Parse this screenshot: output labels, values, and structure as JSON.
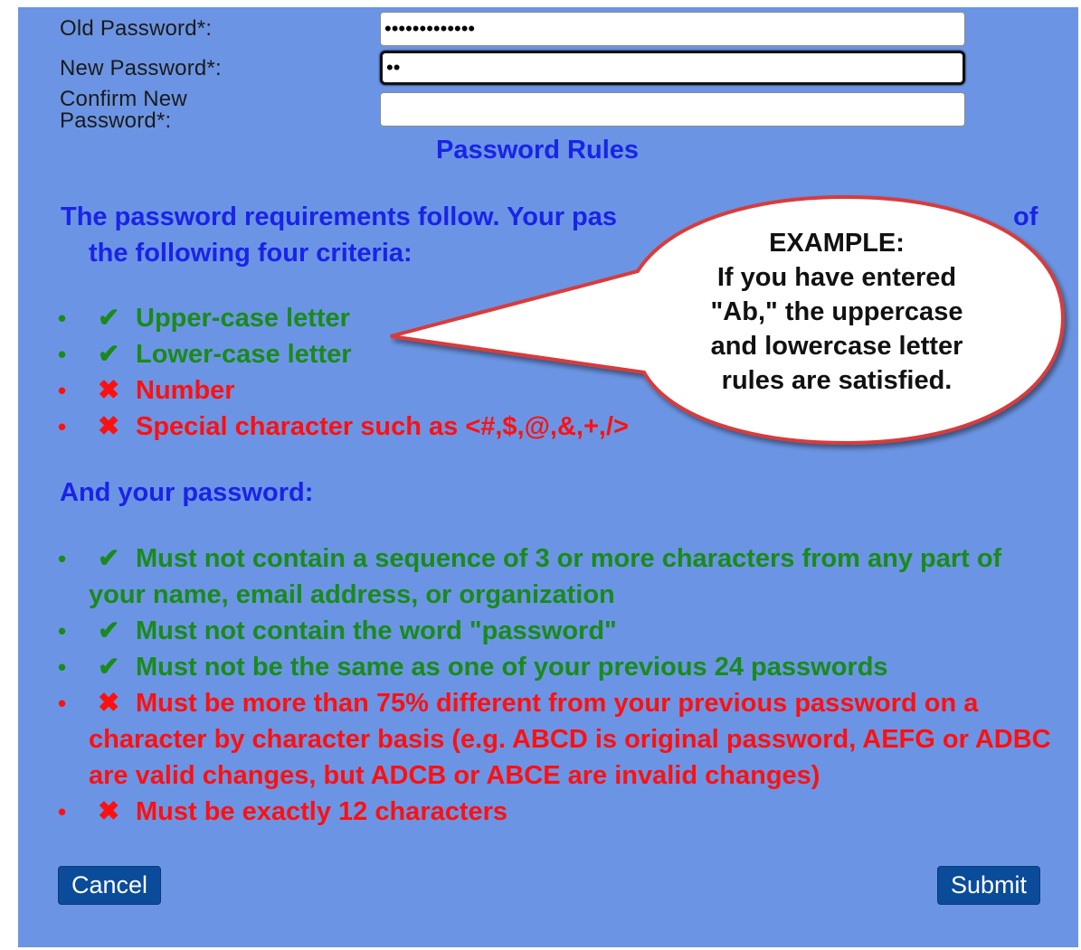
{
  "form": {
    "old_password": {
      "label": "Old Password*:",
      "value": "•••••••••••••"
    },
    "new_password": {
      "label": "New Password*:",
      "value": "••"
    },
    "confirm_password": {
      "label_line1": "Confirm New",
      "label_line2": "Password*:",
      "value": ""
    }
  },
  "rules": {
    "title": "Password Rules",
    "intro_line1": "The password requirements follow. Your pas",
    "intro_end": "of",
    "intro_line2": "the following four criteria:",
    "criteria": [
      {
        "text": "Upper-case letter",
        "ok": true,
        "icon": "check-icon"
      },
      {
        "text": "Lower-case letter",
        "ok": true,
        "icon": "check-icon"
      },
      {
        "text": "Number",
        "ok": false,
        "icon": "x-icon"
      },
      {
        "text": "Special character such as <#,$,@,&,+,/>",
        "ok": false,
        "icon": "x-icon"
      }
    ],
    "and_heading": "And your password:",
    "requirements": [
      {
        "text": "Must not contain a sequence of 3 or more characters from any part of your name, email address, or organization",
        "ok": true,
        "icon": "check-icon"
      },
      {
        "text": "Must not contain the word \"password\"",
        "ok": true,
        "icon": "check-icon"
      },
      {
        "text": "Must not be the same as one of your previous 24 passwords",
        "ok": true,
        "icon": "check-icon"
      },
      {
        "text": "Must be more than 75% different from your previous password on a character by character basis (e.g. ABCD is original password, AEFG or ADBC are valid changes, but ADCB or ABCE are invalid changes)",
        "ok": false,
        "icon": "x-icon"
      },
      {
        "text": "Must be exactly 12 characters",
        "ok": false,
        "icon": "x-icon"
      }
    ]
  },
  "buttons": {
    "cancel": "Cancel",
    "submit": "Submit"
  },
  "callout": {
    "heading": "EXAMPLE:",
    "line1": "If you have entered",
    "line2": "\"Ab,\" the uppercase",
    "line3": "and lowercase letter",
    "line4": "rules are satisfied."
  },
  "colors": {
    "panel": "#6b95e4",
    "heading_blue": "#1a23e8",
    "ok_green": "#1a8a1a",
    "fail_red": "#ff1010",
    "button": "#0a4c99",
    "callout_border": "#d93a3a"
  }
}
